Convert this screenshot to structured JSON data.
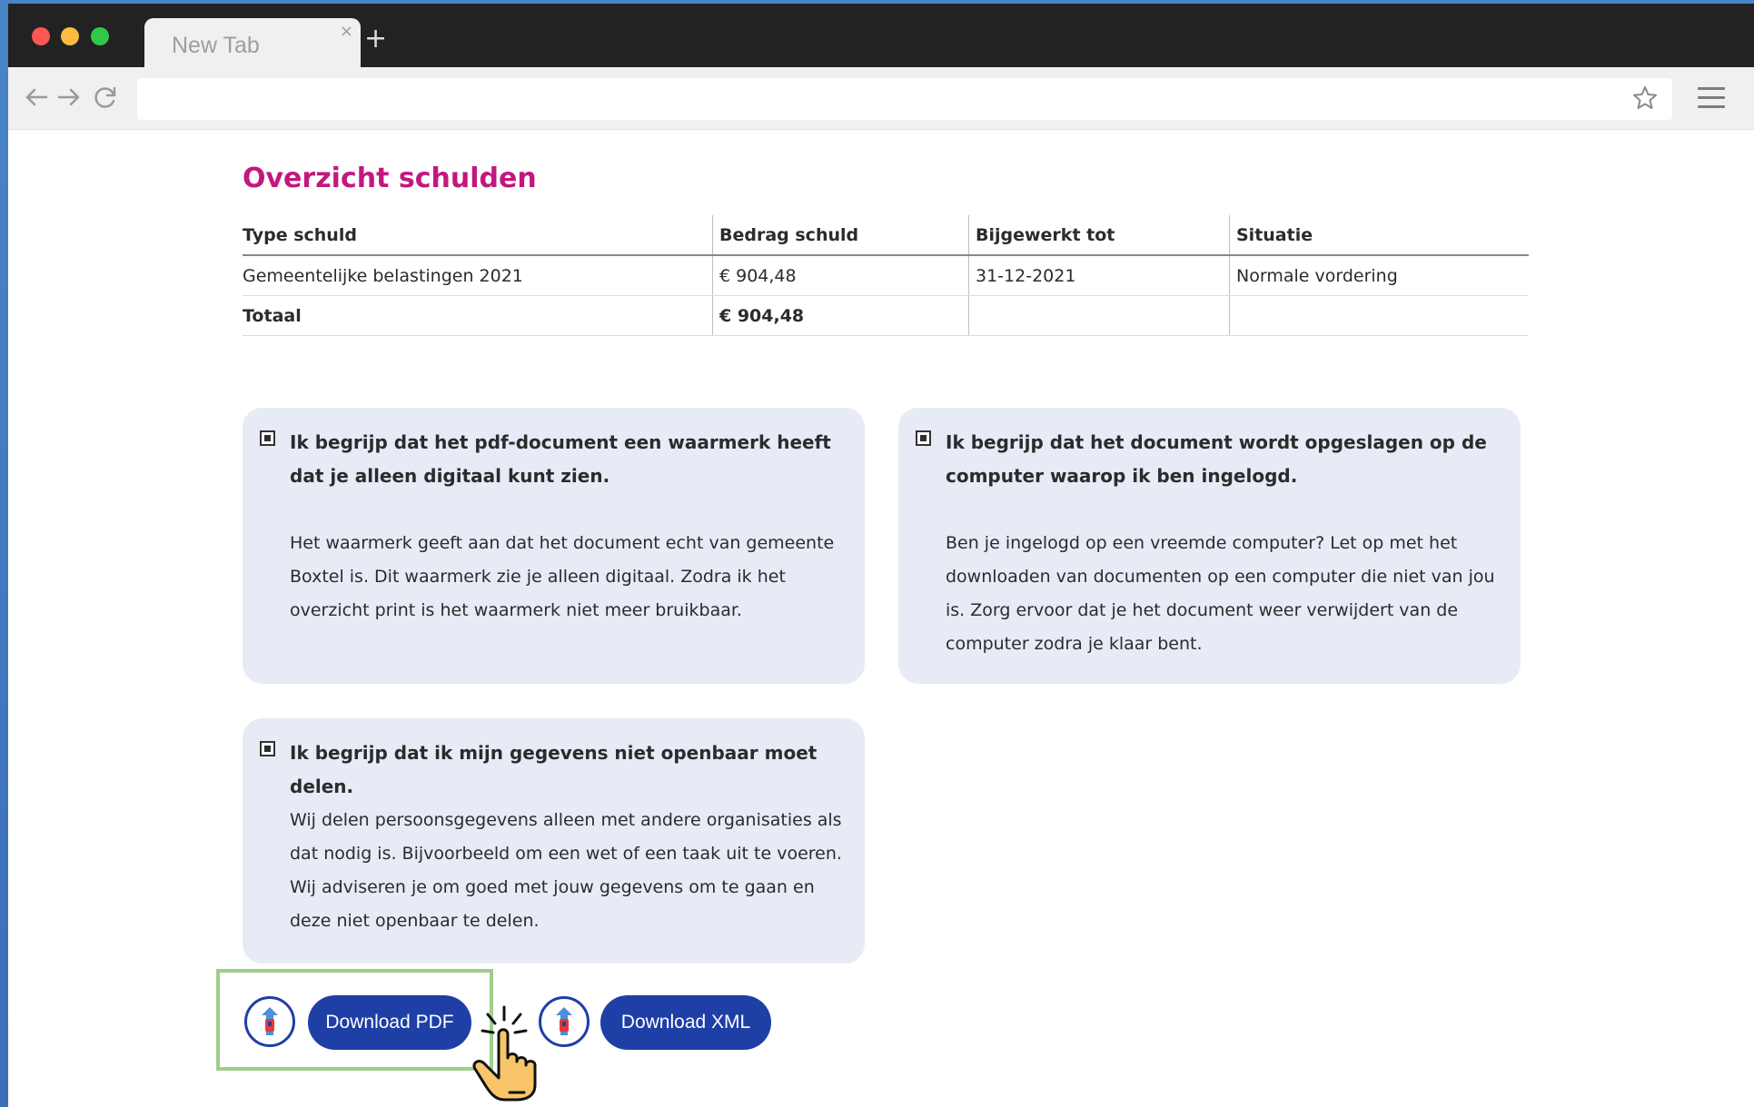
{
  "browser": {
    "tab_title": "New Tab",
    "tab_close": "×",
    "new_tab": "+",
    "address": ""
  },
  "page": {
    "title": "Overzicht schulden",
    "table": {
      "headers": [
        "Type schuld",
        "Bedrag schuld",
        "Bijgewerkt tot",
        "Situatie"
      ],
      "rows": [
        [
          "Gemeentelijke belastingen 2021",
          "€ 904,48",
          "31-12-2021",
          "Normale vordering"
        ]
      ],
      "total": {
        "label": "Totaal",
        "amount": "€ 904,48"
      }
    },
    "cards": [
      {
        "heading": "Ik begrijp dat het pdf-document een waarmerk heeft dat je alleen digitaal kunt zien.",
        "text": "Het waarmerk geeft aan dat het document echt van gemeente Boxtel is. Dit waarmerk zie je alleen digitaal. Zodra ik het overzicht print is het waarmerk niet meer bruikbaar.",
        "checked": true
      },
      {
        "heading": "Ik begrijp dat het document wordt opgeslagen op de computer waarop ik ben ingelogd.",
        "text": "Ben je ingelogd op een vreemde computer? Let op met het downloaden van documenten op een computer die niet van jou is. Zorg ervoor dat je het document weer verwijdert van de computer zodra je klaar bent.",
        "checked": true
      },
      {
        "heading": "Ik begrijp dat ik mijn gegevens niet openbaar moet delen.",
        "text": "Wij delen persoonsgegevens alleen met andere organisaties als dat nodig is. Bijvoorbeeld om een wet of een taak uit te voeren. Wij adviseren je om goed met jouw gegevens om te gaan en deze niet openbaar te delen.",
        "checked": true
      }
    ],
    "buttons": {
      "download_pdf": "Download PDF",
      "download_xml": "Download XML"
    }
  },
  "colors": {
    "title": "#c2187d",
    "card_bg": "#e6ebf6",
    "button_bg": "#1e3fa6",
    "highlight": "#9fcf8a",
    "desktop_bg": "#3b6fb8"
  },
  "icons": [
    "back-arrow-icon",
    "forward-arrow-icon",
    "reload-icon",
    "star-icon",
    "hamburger-menu-icon",
    "checkbox-checked-icon",
    "download-document-icon",
    "pointer-hand-icon"
  ]
}
